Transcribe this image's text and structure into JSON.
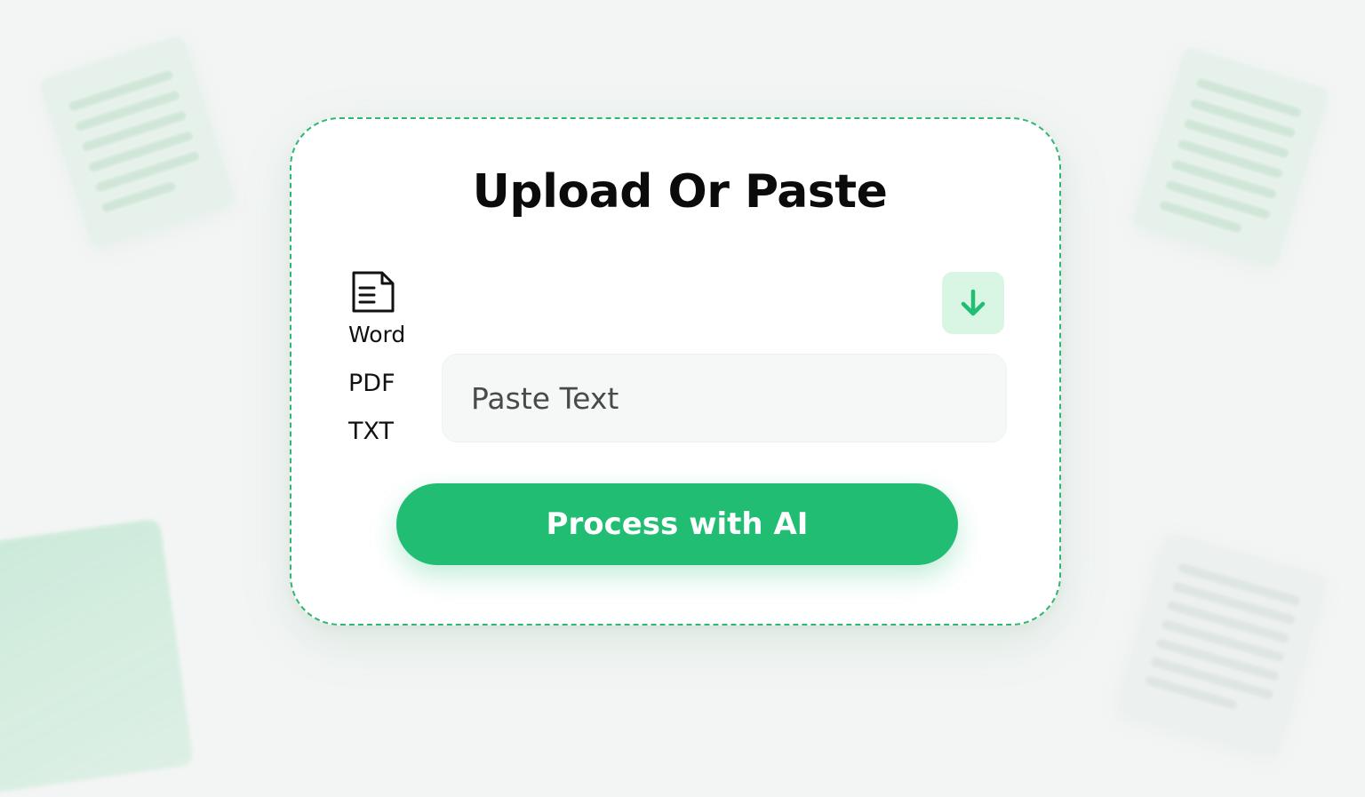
{
  "card": {
    "title": "Upload Or Paste"
  },
  "file_types": {
    "icon": "document-icon",
    "items": [
      "Word",
      "PDF",
      "TXT"
    ]
  },
  "download": {
    "icon": "arrow-down-icon"
  },
  "paste": {
    "placeholder": "Paste Text"
  },
  "process": {
    "label": "Process with AI"
  },
  "colors": {
    "accent": "#20bd72",
    "accent_light": "#d9f5e4",
    "border_dashed": "#2fb870",
    "background": "#f3f5f4"
  }
}
